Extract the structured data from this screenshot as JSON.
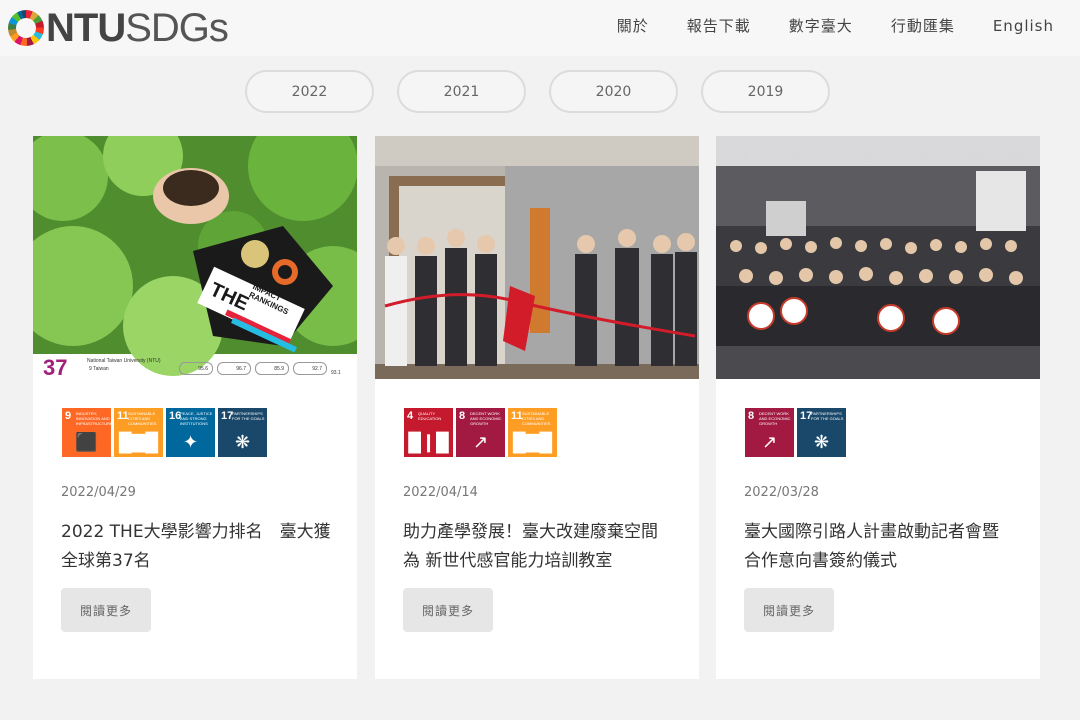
{
  "header": {
    "logo_ntu": "NTU",
    "logo_sdgs": "SDGs",
    "nav": [
      "關於",
      "報告下載",
      "數字臺大",
      "行動匯集",
      "English"
    ]
  },
  "years": [
    "2022",
    "2021",
    "2020",
    "2019"
  ],
  "cards": [
    {
      "date": "2022/04/29",
      "title": "2022 THE大學影響力排名　臺大獲全球第37名",
      "read_more": "閱讀更多",
      "image": {
        "rank": "37",
        "uni": "National Taiwan University (NTU)",
        "loc": "9 Taiwan",
        "badge": "THE",
        "badge_text": "IMPACT RANKINGS",
        "scores": [
          "95.6",
          "96.7",
          "85.9",
          "92.7"
        ],
        "overall": "93.1"
      },
      "sdgs": [
        {
          "num": "9",
          "label": "INDUSTRY, INNOVATION AND INFRASTRUCTURE",
          "color": "#fd6925",
          "icon": "cubes-icon"
        },
        {
          "num": "11",
          "label": "SUSTAINABLE CITIES AND COMMUNITIES",
          "color": "#fd9d24",
          "icon": "city-icon"
        },
        {
          "num": "16",
          "label": "PEACE, JUSTICE AND STRONG INSTITUTIONS",
          "color": "#00689d",
          "icon": "dove-icon"
        },
        {
          "num": "17",
          "label": "PARTNERSHIPS FOR THE GOALS",
          "color": "#19486a",
          "icon": "rings-icon"
        }
      ]
    },
    {
      "date": "2022/04/14",
      "title": "助力產學發展！臺大改建廢棄空間為 新世代感官能力培訓教室",
      "read_more": "閱讀更多",
      "sdgs": [
        {
          "num": "4",
          "label": "QUALITY EDUCATION",
          "color": "#c5192d",
          "icon": "book-icon"
        },
        {
          "num": "8",
          "label": "DECENT WORK AND ECONOMIC GROWTH",
          "color": "#a21942",
          "icon": "growth-icon"
        },
        {
          "num": "11",
          "label": "SUSTAINABLE CITIES AND COMMUNITIES",
          "color": "#fd9d24",
          "icon": "city-icon"
        }
      ]
    },
    {
      "date": "2022/03/28",
      "title": "臺大國際引路人計畫啟動記者會暨合作意向書簽約儀式",
      "read_more": "閱讀更多",
      "sdgs": [
        {
          "num": "8",
          "label": "DECENT WORK AND ECONOMIC GROWTH",
          "color": "#a21942",
          "icon": "growth-icon"
        },
        {
          "num": "17",
          "label": "PARTNERSHIPS FOR THE GOALS",
          "color": "#19486a",
          "icon": "rings-icon"
        }
      ]
    }
  ]
}
